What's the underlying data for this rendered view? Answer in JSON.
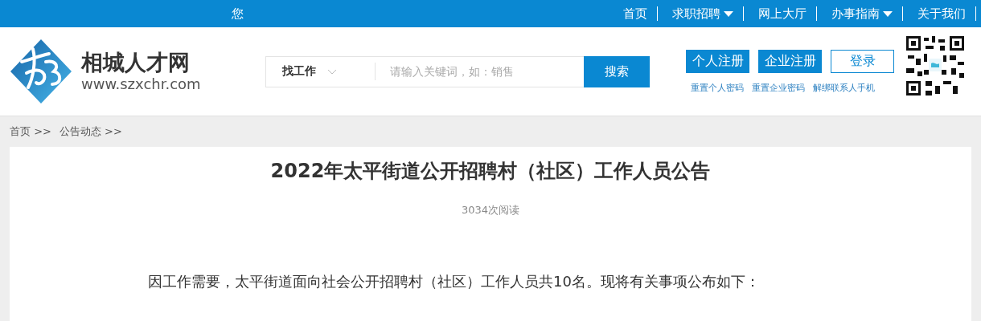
{
  "top_bar": {
    "greeting": "您",
    "nav": [
      {
        "label": "首页",
        "dropdown": false
      },
      {
        "label": "求职招聘",
        "dropdown": true
      },
      {
        "label": "网上大厅",
        "dropdown": false
      },
      {
        "label": "办事指南",
        "dropdown": true
      },
      {
        "label": "关于我们",
        "dropdown": false
      }
    ]
  },
  "header": {
    "site_name": "相城人才网",
    "site_url": "www.szxchr.com",
    "search": {
      "category": "找工作",
      "placeholder": "请输入关键词，如：销售",
      "button": "搜索"
    },
    "account_buttons": [
      {
        "label": "个人注册",
        "kind": "filled"
      },
      {
        "label": "企业注册",
        "kind": "filled"
      },
      {
        "label": "登录",
        "kind": "outline"
      }
    ],
    "account_links": [
      "重置个人密码",
      "重置企业密码",
      "解绑联系人手机"
    ]
  },
  "breadcrumb": [
    "首页 >>",
    "公告动态 >>"
  ],
  "article": {
    "title": "2022年太平街道公开招聘村（社区）工作人员公告",
    "views": "3034次阅读",
    "paragraphs": [
      "因工作需要，太平街道面向社会公开招聘村（社区）工作人员共10名。现将有关事项公布如下："
    ]
  }
}
